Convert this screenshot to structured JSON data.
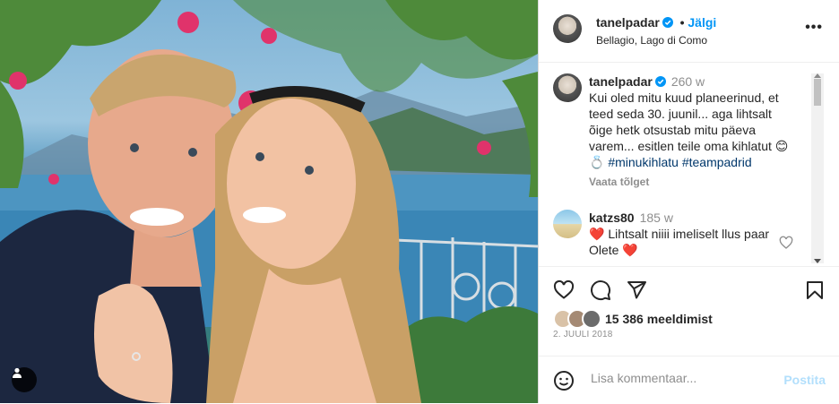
{
  "post": {
    "username": "tanelpadar",
    "follow_label": "Jälgi",
    "location": "Bellagio, Lago di Como",
    "more_icon": "more-horizontal-icon"
  },
  "caption": {
    "username": "tanelpadar",
    "time": "260 w",
    "text": "Kui oled mitu kuud planeerinud, et teed seda 30. juunil... aga lihtsalt õige hetk otsustab mitu päeva varem... esitlen teile oma kihlatut 😊",
    "ring_emoji": "💍",
    "hashtag1": "#minukihlatu",
    "hashtag2": "#teampadrid",
    "translate_label": "Vaata tõlget"
  },
  "comment": {
    "username": "katzs80",
    "time": "185 w",
    "heart1": "❤️",
    "text": "Lihtsalt niiii imeliselt llus paar Olete",
    "heart2": "❤️"
  },
  "actions": {
    "likes": "15 386 meeldimist",
    "date": "2. JUULI 2018"
  },
  "add_comment": {
    "placeholder": "Lisa kommentaar...",
    "post_label": "Postita"
  },
  "colors": {
    "accent": "#0095f6",
    "link": "#00376b",
    "muted": "#8e8e8e",
    "heart": "#ed4956"
  }
}
